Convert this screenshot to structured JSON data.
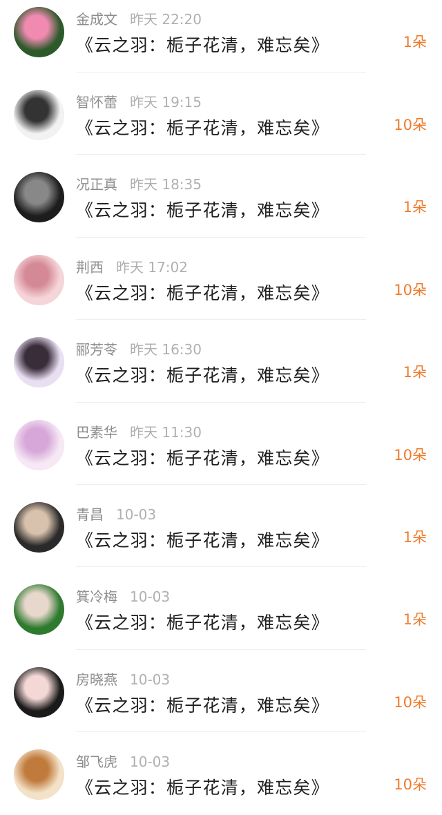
{
  "items": [
    {
      "name": "金成文",
      "time": "昨天 22:20",
      "work": "《云之羽：栀子花清，难忘矣》",
      "qty": "1朵",
      "avatar_icon": "lotus-avatar-icon",
      "avatar_colors": [
        "#2d5a2b",
        "#f08ab0"
      ]
    },
    {
      "name": "智怀蕾",
      "time": "昨天 19:15",
      "work": "《云之羽：栀子花清，难忘矣》",
      "qty": "10朵",
      "avatar_icon": "person-monochrome-avatar-icon",
      "avatar_colors": [
        "#f2f2f2",
        "#333333"
      ]
    },
    {
      "name": "况正真",
      "time": "昨天 18:35",
      "work": "《云之羽：栀子花清，难忘矣》",
      "qty": "1朵",
      "avatar_icon": "person-dark-avatar-icon",
      "avatar_colors": [
        "#1d1d1d",
        "#888888"
      ]
    },
    {
      "name": "荆西",
      "time": "昨天 17:02",
      "work": "《云之羽：栀子花清，难忘矣》",
      "qty": "10朵",
      "avatar_icon": "anime-girl-avatar-icon",
      "avatar_colors": [
        "#f6d5d9",
        "#d48a96"
      ]
    },
    {
      "name": "郦芳苓",
      "time": "昨天 16:30",
      "work": "《云之羽：栀子花清，难忘矣》",
      "qty": "1朵",
      "avatar_icon": "couple-illustration-avatar-icon",
      "avatar_colors": [
        "#e9dff3",
        "#3a2d3a"
      ]
    },
    {
      "name": "巴素华",
      "time": "昨天 11:30",
      "work": "《云之羽：栀子花清，难忘矣》",
      "qty": "10朵",
      "avatar_icon": "anime-pink-avatar-icon",
      "avatar_colors": [
        "#f6e8f5",
        "#d6a7d8"
      ]
    },
    {
      "name": "青昌",
      "time": "10-03",
      "work": "《云之羽：栀子花清，难忘矣》",
      "qty": "1朵",
      "avatar_icon": "young-man-avatar-icon",
      "avatar_colors": [
        "#2a2a2a",
        "#d9c2ad"
      ]
    },
    {
      "name": "箕冷梅",
      "time": "10-03",
      "work": "《云之羽：栀子花清，难忘矣》",
      "qty": "1朵",
      "avatar_icon": "green-cupcakes-avatar-icon",
      "avatar_colors": [
        "#2e7a2f",
        "#e8d7cc"
      ]
    },
    {
      "name": "房晓燕",
      "time": "10-03",
      "work": "《云之羽：栀子花清，难忘矣》",
      "qty": "10朵",
      "avatar_icon": "girl-selfie-avatar-icon",
      "avatar_colors": [
        "#1a1a1a",
        "#f3d8d5"
      ]
    },
    {
      "name": "邹飞虎",
      "time": "10-03",
      "work": "《云之羽：栀子花清，难忘矣》",
      "qty": "10朵",
      "avatar_icon": "anime-boy-avatar-icon",
      "avatar_colors": [
        "#f3e2c8",
        "#c07a3c"
      ]
    }
  ],
  "colors": {
    "accent": "#ef7b2c",
    "meta_gray": "#9a9a9a",
    "divider": "#eeeeee"
  }
}
